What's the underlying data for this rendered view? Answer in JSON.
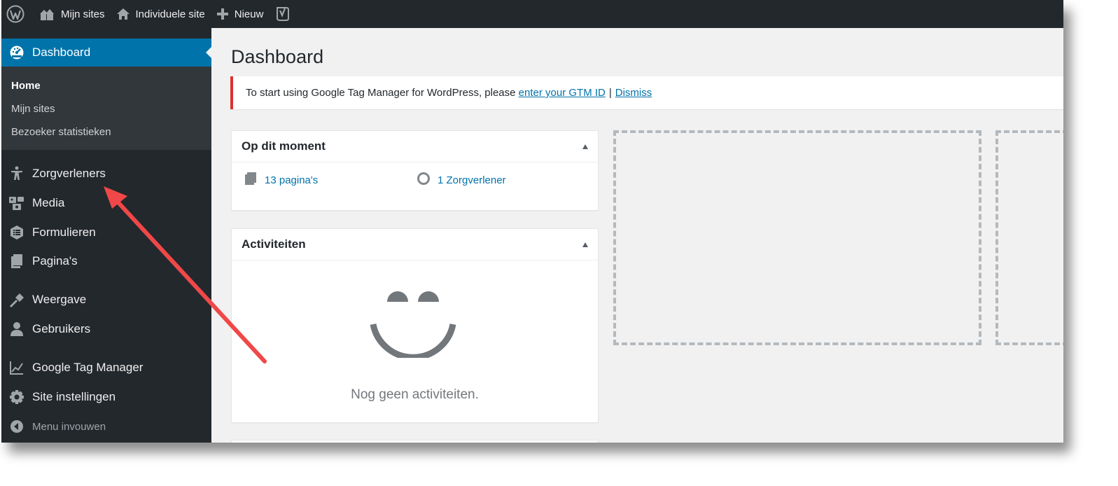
{
  "adminbar": {
    "wp_logo_icon": "wordpress-logo-icon",
    "items": [
      {
        "label": "Mijn sites",
        "icon": "my-sites-icon"
      },
      {
        "label": "Individuele site",
        "icon": "home-icon"
      },
      {
        "label": "Nieuw",
        "icon": "plus-icon"
      }
    ],
    "yoast_icon": "yoast-seo-icon"
  },
  "sidebar": {
    "current": {
      "label": "Dashboard",
      "icon": "dashboard-icon"
    },
    "submenu": [
      {
        "label": "Home",
        "active": true
      },
      {
        "label": "Mijn sites",
        "active": false
      },
      {
        "label": "Bezoeker statistieken",
        "active": false
      }
    ],
    "items": [
      {
        "label": "Zorgverleners",
        "icon": "universal-access-icon"
      },
      {
        "label": "Media",
        "icon": "media-icon"
      },
      {
        "label": "Formulieren",
        "icon": "forms-icon"
      },
      {
        "label": "Pagina's",
        "icon": "pages-icon"
      },
      {
        "label": "Weergave",
        "icon": "appearance-icon"
      },
      {
        "label": "Gebruikers",
        "icon": "users-icon"
      },
      {
        "label": "Google Tag Manager",
        "icon": "chart-line-icon"
      },
      {
        "label": "Site instellingen",
        "icon": "settings-gear-icon"
      }
    ],
    "collapse": {
      "label": "Menu invouwen",
      "icon": "collapse-icon"
    }
  },
  "main": {
    "title": "Dashboard",
    "notice": {
      "text": "To start using Google Tag Manager for WordPress, please",
      "link": "enter your GTM ID",
      "separator": "|",
      "dismiss": "Dismiss"
    },
    "glance": {
      "title": "Op dit moment",
      "items": [
        {
          "label": "13 pagina's",
          "icon": "pages-icon"
        },
        {
          "label": "1 Zorgverlener",
          "icon": "circle-icon"
        }
      ]
    },
    "activity": {
      "title": "Activiteiten",
      "empty_text": "Nog geen activiteiten.",
      "icon": "smiley-icon"
    }
  },
  "colors": {
    "adminbar_bg": "#23282d",
    "sidebar_bg": "#23282d",
    "submenu_bg": "#32373c",
    "accent": "#0073aa",
    "notice_border": "#dc3232",
    "annotation_arrow": "#f04848"
  }
}
